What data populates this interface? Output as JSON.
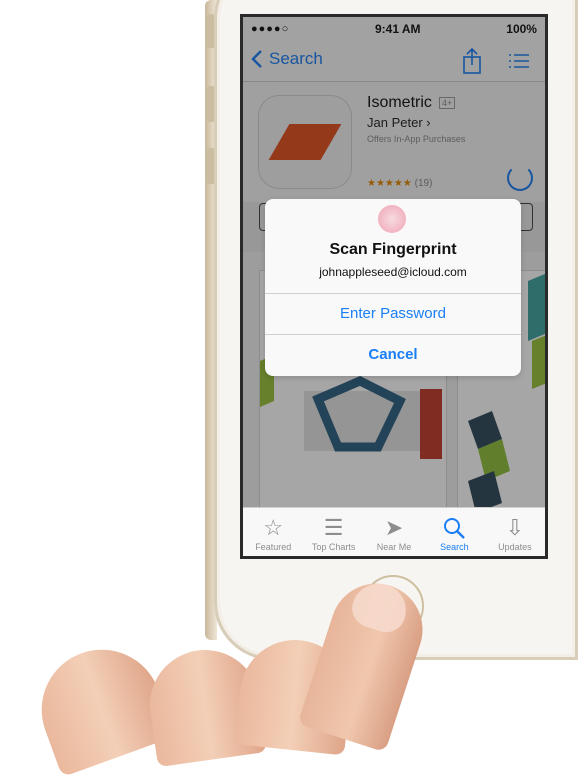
{
  "status_bar": {
    "signal": "●●●●○",
    "time": "9:41 AM",
    "battery": "100%"
  },
  "nav": {
    "back_label": "Search"
  },
  "app": {
    "name": "Isometric",
    "age_rating": "4+",
    "developer": "Jan Peter ›",
    "iap_note": "Offers In-App Purchases",
    "stars": "★★★★★",
    "rating_count": "(19)"
  },
  "alert": {
    "title": "Scan Fingerprint",
    "account": "johnappleseed@icloud.com",
    "enter_password": "Enter Password",
    "cancel": "Cancel"
  },
  "tabs": [
    {
      "label": "Featured",
      "icon": "star-icon"
    },
    {
      "label": "Top Charts",
      "icon": "list-icon"
    },
    {
      "label": "Near Me",
      "icon": "location-icon"
    },
    {
      "label": "Search",
      "icon": "search-icon",
      "active": true
    },
    {
      "label": "Updates",
      "icon": "download-icon"
    }
  ],
  "colors": {
    "accent": "#1a7ef5",
    "app_icon_shape": "#e2501c"
  }
}
